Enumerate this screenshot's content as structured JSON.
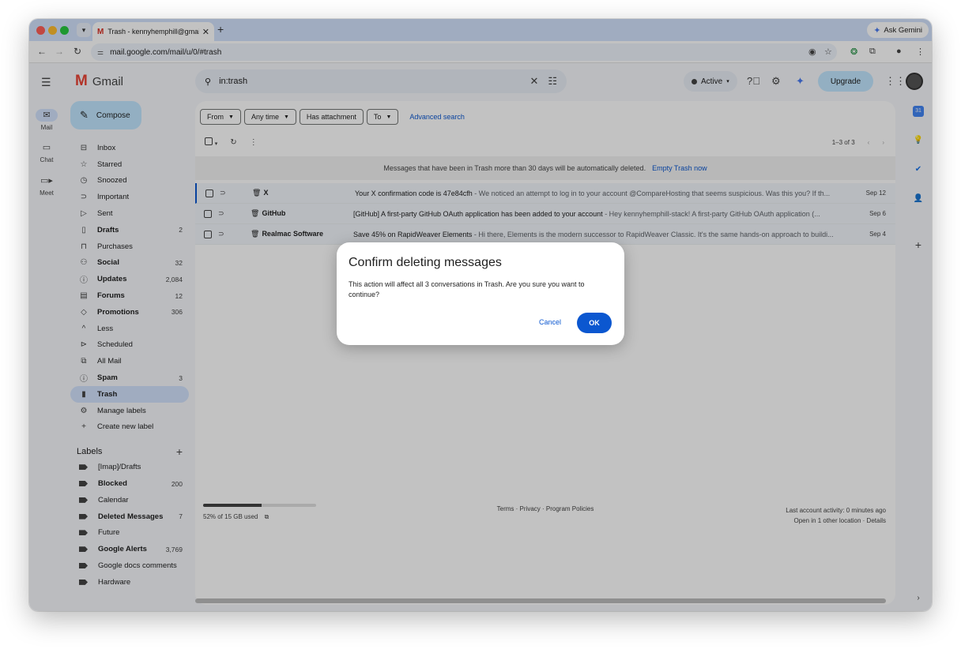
{
  "browser": {
    "tab_title": "Trash - kennyhemphill@gmail",
    "tab_favicon": "M",
    "ask_gemini": "Ask Gemini",
    "url": "mail.google.com/mail/u/0/#trash"
  },
  "gmail": {
    "logo_text": "Gmail",
    "search_query": "in:trash",
    "status": "Active",
    "upgrade": "Upgrade",
    "compose": "Compose",
    "rail": [
      {
        "label": "Mail",
        "icon": "mail-icon"
      },
      {
        "label": "Chat",
        "icon": "chat-icon"
      },
      {
        "label": "Meet",
        "icon": "meet-icon"
      }
    ],
    "nav": [
      {
        "label": "Inbox",
        "count": "",
        "icon": "inbox-icon",
        "bold": false
      },
      {
        "label": "Starred",
        "count": "",
        "icon": "star-icon",
        "bold": false
      },
      {
        "label": "Snoozed",
        "count": "",
        "icon": "clock-icon",
        "bold": false
      },
      {
        "label": "Important",
        "count": "",
        "icon": "important-icon",
        "bold": false
      },
      {
        "label": "Sent",
        "count": "",
        "icon": "send-icon",
        "bold": false
      },
      {
        "label": "Drafts",
        "count": "2",
        "icon": "draft-icon",
        "bold": true
      },
      {
        "label": "Purchases",
        "count": "",
        "icon": "bag-icon",
        "bold": false
      },
      {
        "label": "Social",
        "count": "32",
        "icon": "people-icon",
        "bold": true
      },
      {
        "label": "Updates",
        "count": "2,084",
        "icon": "info-icon",
        "bold": true
      },
      {
        "label": "Forums",
        "count": "12",
        "icon": "forum-icon",
        "bold": true
      },
      {
        "label": "Promotions",
        "count": "306",
        "icon": "tag-icon",
        "bold": true
      },
      {
        "label": "Less",
        "count": "",
        "icon": "chevron-up-icon",
        "bold": false
      },
      {
        "label": "Scheduled",
        "count": "",
        "icon": "scheduled-icon",
        "bold": false
      },
      {
        "label": "All Mail",
        "count": "",
        "icon": "all-mail-icon",
        "bold": false
      },
      {
        "label": "Spam",
        "count": "3",
        "icon": "spam-icon",
        "bold": true
      },
      {
        "label": "Trash",
        "count": "",
        "icon": "trash-icon",
        "bold": true,
        "selected": true
      },
      {
        "label": "Manage labels",
        "count": "",
        "icon": "gear-icon",
        "bold": false
      },
      {
        "label": "Create new label",
        "count": "",
        "icon": "plus-icon",
        "bold": false
      }
    ],
    "labels_heading": "Labels",
    "labels": [
      {
        "label": "[Imap]/Drafts",
        "count": "",
        "bold": false
      },
      {
        "label": "Blocked",
        "count": "200",
        "bold": true
      },
      {
        "label": "Calendar",
        "count": "",
        "bold": false
      },
      {
        "label": "Deleted Messages",
        "count": "7",
        "bold": true
      },
      {
        "label": "Future",
        "count": "",
        "bold": false
      },
      {
        "label": "Google Alerts",
        "count": "3,769",
        "bold": true
      },
      {
        "label": "Google docs comments",
        "count": "",
        "bold": false
      },
      {
        "label": "Hardware",
        "count": "",
        "bold": false
      }
    ],
    "filters": [
      "From",
      "Any time",
      "Has attachment",
      "To"
    ],
    "advanced_search": "Advanced search",
    "pagination": "1–3 of 3",
    "trash_notice": "Messages that have been in Trash more than 30 days will be automatically deleted.",
    "empty_trash": "Empty Trash now",
    "emails": [
      {
        "sender": "X",
        "subject": "Your X confirmation code is 47e84cfh",
        "snippet": " - We noticed an attempt to log in to your account @CompareHosting that seems suspicious. Was this you? If th...",
        "date": "Sep 12"
      },
      {
        "sender": "GitHub",
        "subject": "[GitHub] A first-party GitHub OAuth application has been added to your account",
        "snippet": " - Hey kennyhemphill-stack! A first-party GitHub OAuth application (...",
        "date": "Sep 6"
      },
      {
        "sender": "Realmac Software",
        "subject": "Save 45% on RapidWeaver Elements",
        "snippet": " - Hi there, Elements is the modern successor to RapidWeaver Classic. It's the same hands-on approach to buildi...",
        "date": "Sep 4"
      }
    ],
    "storage": {
      "text": "52% of 15 GB used",
      "percent": 52
    },
    "footer_terms": "Terms · Privacy · Program Policies",
    "last_activity": "Last account activity: 0 minutes ago",
    "other_location": "Open in 1 other location · Details"
  },
  "dialog": {
    "title": "Confirm deleting messages",
    "body": "This action will affect all 3 conversations in Trash. Are you sure you want to continue?",
    "cancel": "Cancel",
    "ok": "OK"
  }
}
